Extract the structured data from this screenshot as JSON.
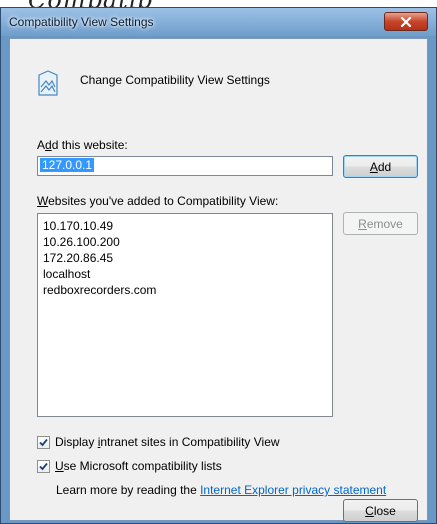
{
  "behind_text": "Compatib",
  "window": {
    "title": "Compatibility View Settings",
    "close_label": "x"
  },
  "header": {
    "text": "Change Compatibility View Settings",
    "icon": "compatibility-view-icon"
  },
  "add_section": {
    "label_pre": "A",
    "label_accel": "d",
    "label_post": "d this website:",
    "input_value": "127.0.0.1",
    "add_pre": "",
    "add_accel": "A",
    "add_post": "dd"
  },
  "list_section": {
    "label_pre": "",
    "label_accel": "W",
    "label_post": "ebsites you've added to Compatibility View:",
    "items": [
      "10.170.10.49",
      "10.26.100.200",
      "172.20.86.45",
      "localhost",
      "redboxrecorders.com"
    ],
    "remove_pre": "",
    "remove_accel": "R",
    "remove_post": "emove"
  },
  "options": {
    "intranet_pre": "Display ",
    "intranet_accel": "i",
    "intranet_post": "ntranet sites in Compatibility View",
    "intranet_checked": true,
    "ms_pre": "",
    "ms_accel": "U",
    "ms_post": "se Microsoft compatibility lists",
    "ms_checked": true
  },
  "learn_more": {
    "prefix": "Learn more by reading the ",
    "link": "Internet Explorer privacy statement"
  },
  "footer": {
    "close_pre": "",
    "close_accel": "C",
    "close_post": "lose"
  },
  "colors": {
    "frame": "#6a98c4",
    "client": "#f0f0f0",
    "selection": "#3399ff",
    "link": "#0066cc"
  }
}
